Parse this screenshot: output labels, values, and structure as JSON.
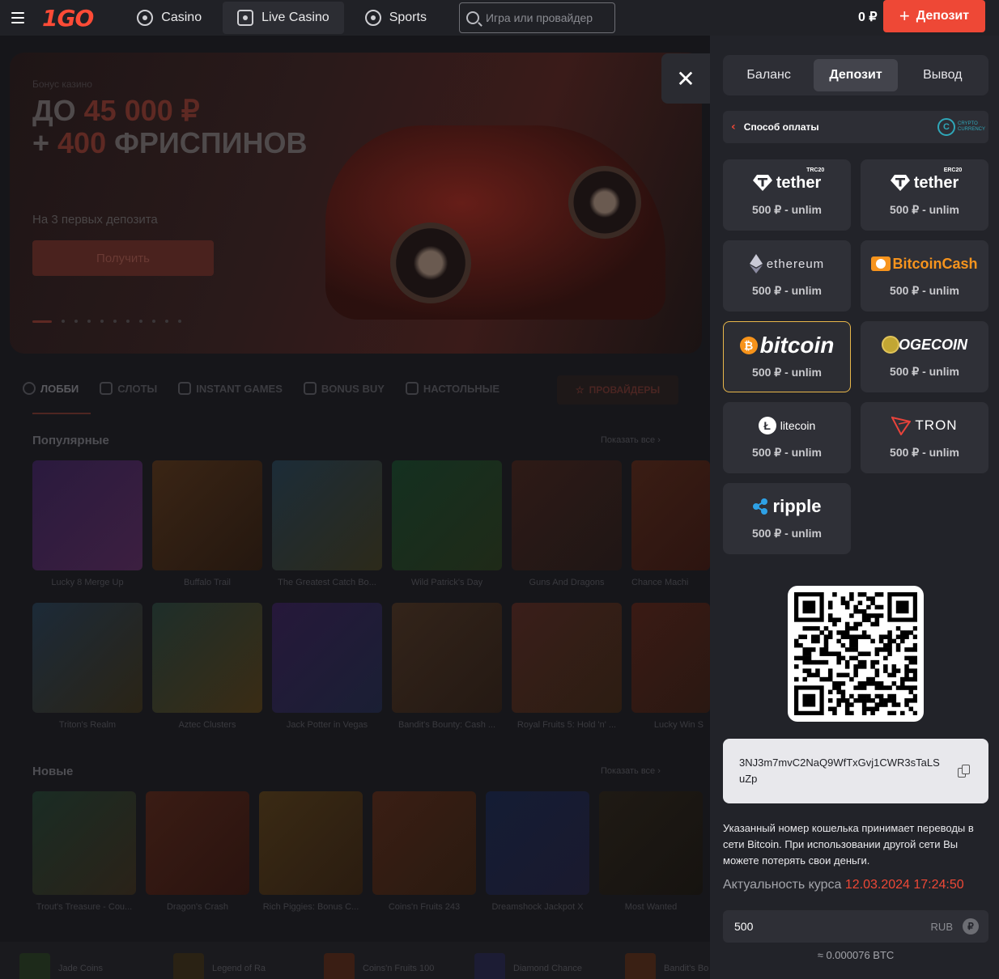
{
  "header": {
    "logo": "1GO",
    "nav": [
      {
        "label": "Casino",
        "icon": "casino-chip-icon"
      },
      {
        "label": "Live Casino",
        "icon": "live-casino-icon"
      },
      {
        "label": "Sports",
        "icon": "soccer-ball-icon"
      }
    ],
    "search_placeholder": "Игра или провайдер",
    "balance": "0 ₽",
    "deposit_label": "Депозит"
  },
  "hero": {
    "subtitle": "Бонус казино",
    "title_prefix": "ДО ",
    "title_amount": "45 000 ₽",
    "title_line2_prefix": "+ ",
    "title_spins": "400",
    "title_line2_suffix": " ФРИСПИНОВ",
    "note": "На 3 первых депозита",
    "button": "Получить"
  },
  "categories": [
    "ЛОББИ",
    "СЛОТЫ",
    "INSTANT GAMES",
    "BONUS BUY",
    "НАСТОЛЬНЫЕ"
  ],
  "providers_button": "ПРОВАЙДЕРЫ",
  "popular": {
    "title": "Популярные",
    "show_all": "Показать все",
    "games_row1": [
      "Lucky 8 Merge Up",
      "Buffalo Trail",
      "The Greatest Catch Bo...",
      "Wild Patrick's Day",
      "Guns And Dragons",
      "Chance Machi"
    ],
    "games_row2": [
      "Triton's Realm",
      "Aztec Clusters",
      "Jack Potter in Vegas",
      "Bandit's Bounty: Cash ...",
      "Royal Fruits 5: Hold 'n' ...",
      "Lucky Win S"
    ]
  },
  "new": {
    "title": "Новые",
    "show_all": "Показать все",
    "games": [
      "Trout's Treasure - Cou...",
      "Dragon's Crash",
      "Rich Piggies: Bonus C...",
      "Coins'n Fruits 243",
      "Dreamshock Jackpot X",
      "Most Wanted"
    ]
  },
  "bottom_strip": [
    "Jade Coins",
    "Legend of Ra",
    "Coins'n Fruits 100",
    "Diamond Chance",
    "Bandit's Bo"
  ],
  "panel": {
    "tabs": [
      "Баланс",
      "Депозит",
      "Вывод"
    ],
    "active_tab": "Депозит",
    "method_label": "Способ оплаты",
    "crypto_badge": "CRYPTO CURRENCY",
    "coins": [
      {
        "name": "tether",
        "badge": "TRC20",
        "price": "500 ₽ - unlim"
      },
      {
        "name": "tether",
        "badge": "ERC20",
        "price": "500 ₽ - unlim"
      },
      {
        "name": "ethereum",
        "price": "500 ₽ - unlim"
      },
      {
        "name": "BitcoinCash",
        "price": "500 ₽ - unlim"
      },
      {
        "name": "bitcoin",
        "price": "500 ₽ - unlim",
        "selected": true
      },
      {
        "name": "OGECOIN",
        "price": "500 ₽ - unlim"
      },
      {
        "name": "litecoin",
        "price": "500 ₽ - unlim"
      },
      {
        "name": "TRON",
        "price": "500 ₽ - unlim"
      },
      {
        "name": "ripple",
        "price": "500 ₽ - unlim"
      }
    ],
    "wallet_address": "3NJ3m7mvC2NaQ9WfTxGvj1CWR3sTaLSuZp",
    "note": "Указанный номер кошелька принимает переводы в сети Bitcoin. При использовании другой сети Вы можете потерять свои деньги.",
    "rate_label": "Актуальность курса ",
    "rate_datetime": "12.03.2024 17:24:50",
    "amount_value": "500",
    "amount_currency": "RUB",
    "currency_symbol": "₽",
    "converted": "≈ 0.000076 BTC"
  },
  "colors": {
    "accent": "#ee4836",
    "selected_border": "#e8b74a",
    "panel_bg": "#222329"
  }
}
